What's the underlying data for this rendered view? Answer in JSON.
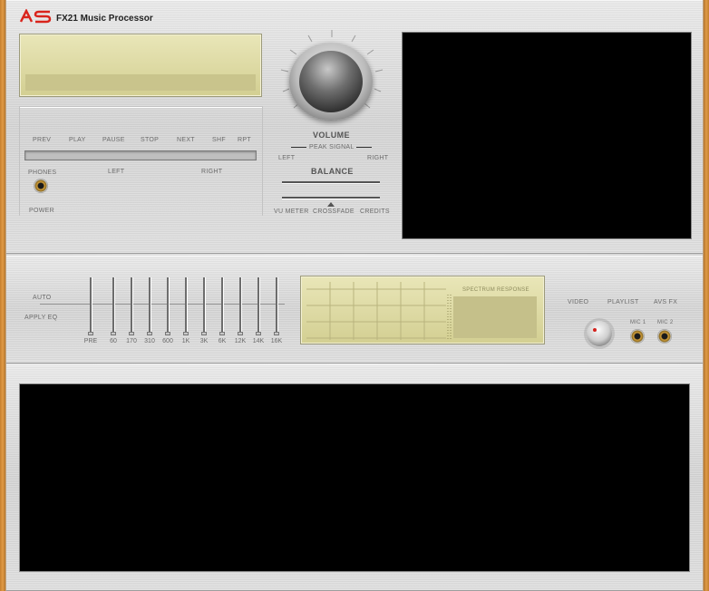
{
  "header": {
    "logo_text": "AS",
    "title": "FX21 Music Processor"
  },
  "transport": {
    "buttons": [
      {
        "label": "PREV",
        "name": "prev-button"
      },
      {
        "label": "PLAY",
        "name": "play-button"
      },
      {
        "label": "PAUSE",
        "name": "pause-button"
      },
      {
        "label": "STOP",
        "name": "stop-button"
      },
      {
        "label": "NEXT",
        "name": "next-button"
      },
      {
        "label": "SHF",
        "name": "shuffle-button"
      },
      {
        "label": "RPT",
        "name": "repeat-button"
      }
    ],
    "left_label": "LEFT",
    "right_label": "RIGHT",
    "phones_label": "PHONES",
    "power_label": "POWER"
  },
  "volume": {
    "label": "VOLUME",
    "peak_signal": "PEAK SIGNAL",
    "left": "LEFT",
    "right": "RIGHT",
    "balance": "BALANCE"
  },
  "bottom_links": {
    "vu_meter": "VU METER",
    "crossfade": "CROSSFADE",
    "credits": "CREDITS"
  },
  "eq": {
    "auto": "AUTO",
    "apply": "APPLY EQ",
    "bands": [
      "PRE",
      "60",
      "170",
      "310",
      "600",
      "1K",
      "3K",
      "6K",
      "12K",
      "14K",
      "16K"
    ]
  },
  "spectrum": {
    "label": "SPECTRUM RESPONSE"
  },
  "right_controls": {
    "video": "VIDEO",
    "playlist": "PLAYLIST",
    "avs_fx": "AVS FX",
    "mic1": "MIC 1",
    "mic2": "MIC 2"
  },
  "colors": {
    "logo": "#d9241c",
    "lcd": "#e2dea6",
    "wood": "#d28a3a"
  }
}
